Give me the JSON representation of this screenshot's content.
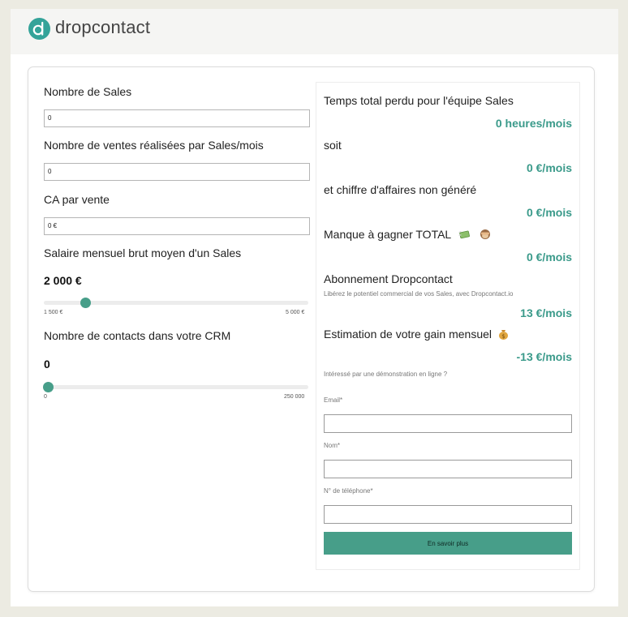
{
  "brand": {
    "name": "dropcontact",
    "color": "#34a399"
  },
  "left": {
    "fields": [
      {
        "label": "Nombre de Sales",
        "value": "0"
      },
      {
        "label": "Nombre de ventes réalisées par Sales/mois",
        "value": "0"
      },
      {
        "label": "CA par vente",
        "value": "0 €"
      }
    ],
    "sliders": [
      {
        "label": "Salaire mensuel brut moyen d'un Sales",
        "value": "2 000 €",
        "min": "1 500 €",
        "max": "5 000 €",
        "level": 0.14
      },
      {
        "label": "Nombre de contacts dans votre CRM",
        "value": "0",
        "min": "0",
        "max": "250 000",
        "level": 0
      }
    ]
  },
  "right": {
    "metrics": [
      {
        "label": "Temps total perdu pour l'équipe Sales",
        "value": "0 heures/mois"
      },
      {
        "label": "soit",
        "value": "0 €/mois"
      },
      {
        "label": "et chiffre d'affaires non généré",
        "value": "0 €/mois"
      },
      {
        "label": "Manque à gagner TOTAL",
        "value": "0 €/mois",
        "icons": [
          "money-with-wings-icon",
          "see-no-evil-monkey-icon"
        ]
      },
      {
        "label": "Abonnement Dropcontact",
        "sublabel": "Libérez le potentiel commercial de vos Sales, avec Dropcontact.io",
        "value": "13 €/mois"
      },
      {
        "label": "Estimation de votre gain mensuel",
        "value": "-13 €/mois",
        "icons": [
          "money-bag-icon"
        ]
      }
    ],
    "form": {
      "intro": "Intéressé par une démonstration en ligne ?",
      "email_label": "Email*",
      "name_label": "Nom*",
      "phone_label": "N° de téléphone*",
      "submit_label": "En savoir plus"
    }
  }
}
